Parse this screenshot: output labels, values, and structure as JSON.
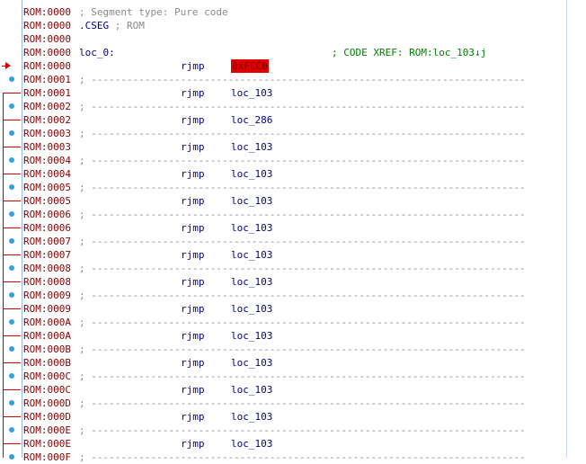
{
  "lines": [
    {
      "addr": "ROM:0000",
      "kind": "comment",
      "text": "; Segment type: Pure code"
    },
    {
      "addr": "ROM:0000",
      "kind": "directive",
      "text": ".CSEG",
      "trail": " ; ROM"
    },
    {
      "addr": "ROM:0000",
      "kind": "blank"
    },
    {
      "addr": "ROM:0000",
      "kind": "label",
      "text": "loc_0:",
      "xref": "; CODE XREF: ROM:loc_103↓j"
    },
    {
      "addr": "ROM:0000",
      "kind": "instr",
      "mnem": "rjmp",
      "opnd": "0xFCC0",
      "highlight": true
    },
    {
      "addr": "ROM:0001",
      "kind": "sep"
    },
    {
      "addr": "ROM:0001",
      "kind": "instr",
      "mnem": "rjmp",
      "opnd": "loc_103"
    },
    {
      "addr": "ROM:0002",
      "kind": "sep"
    },
    {
      "addr": "ROM:0002",
      "kind": "instr",
      "mnem": "rjmp",
      "opnd": "loc_286"
    },
    {
      "addr": "ROM:0003",
      "kind": "sep"
    },
    {
      "addr": "ROM:0003",
      "kind": "instr",
      "mnem": "rjmp",
      "opnd": "loc_103"
    },
    {
      "addr": "ROM:0004",
      "kind": "sep"
    },
    {
      "addr": "ROM:0004",
      "kind": "instr",
      "mnem": "rjmp",
      "opnd": "loc_103"
    },
    {
      "addr": "ROM:0005",
      "kind": "sep"
    },
    {
      "addr": "ROM:0005",
      "kind": "instr",
      "mnem": "rjmp",
      "opnd": "loc_103"
    },
    {
      "addr": "ROM:0006",
      "kind": "sep"
    },
    {
      "addr": "ROM:0006",
      "kind": "instr",
      "mnem": "rjmp",
      "opnd": "loc_103"
    },
    {
      "addr": "ROM:0007",
      "kind": "sep"
    },
    {
      "addr": "ROM:0007",
      "kind": "instr",
      "mnem": "rjmp",
      "opnd": "loc_103"
    },
    {
      "addr": "ROM:0008",
      "kind": "sep"
    },
    {
      "addr": "ROM:0008",
      "kind": "instr",
      "mnem": "rjmp",
      "opnd": "loc_103"
    },
    {
      "addr": "ROM:0009",
      "kind": "sep"
    },
    {
      "addr": "ROM:0009",
      "kind": "instr",
      "mnem": "rjmp",
      "opnd": "loc_103"
    },
    {
      "addr": "ROM:000A",
      "kind": "sep"
    },
    {
      "addr": "ROM:000A",
      "kind": "instr",
      "mnem": "rjmp",
      "opnd": "loc_103"
    },
    {
      "addr": "ROM:000B",
      "kind": "sep"
    },
    {
      "addr": "ROM:000B",
      "kind": "instr",
      "mnem": "rjmp",
      "opnd": "loc_103"
    },
    {
      "addr": "ROM:000C",
      "kind": "sep"
    },
    {
      "addr": "ROM:000C",
      "kind": "instr",
      "mnem": "rjmp",
      "opnd": "loc_103"
    },
    {
      "addr": "ROM:000D",
      "kind": "sep"
    },
    {
      "addr": "ROM:000D",
      "kind": "instr",
      "mnem": "rjmp",
      "opnd": "loc_103"
    },
    {
      "addr": "ROM:000E",
      "kind": "sep"
    },
    {
      "addr": "ROM:000E",
      "kind": "instr",
      "mnem": "rjmp",
      "opnd": "loc_103"
    },
    {
      "addr": "ROM:000F",
      "kind": "sep"
    }
  ],
  "separator_text": "; -------------------------------------------------------------------------",
  "colors": {
    "address": "#8b0000",
    "comment": "#8a8a8a",
    "code": "#00008b",
    "xref": "#008000",
    "highlight": "#e00000",
    "flow_arrow": "#d00000",
    "gutter_dot": "#3aa0d8"
  }
}
